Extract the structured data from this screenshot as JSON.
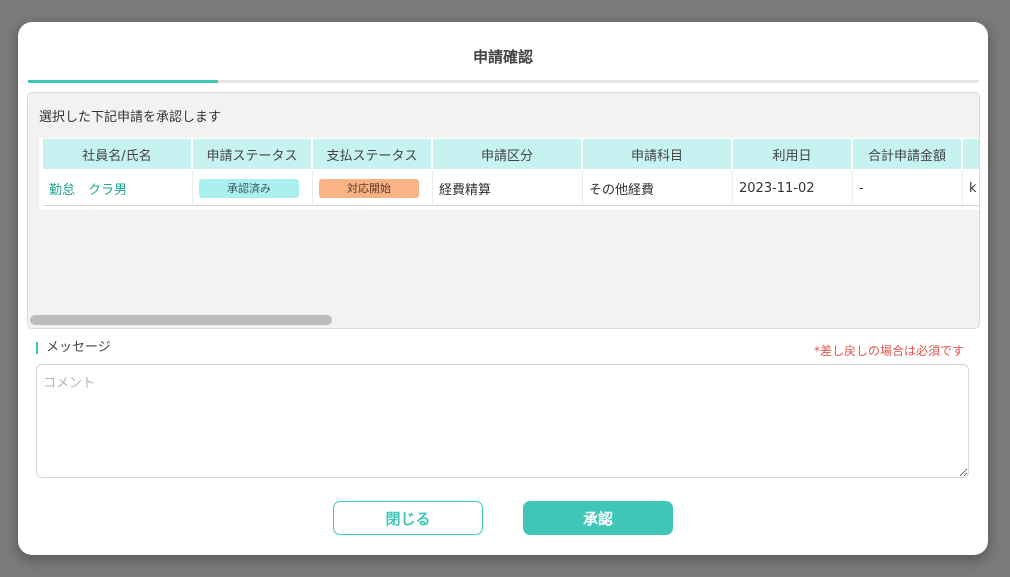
{
  "dialog": {
    "title": "申請確認",
    "instruction": "選択した下記申請を承認します"
  },
  "table": {
    "columns": [
      {
        "key": "name",
        "label": "社員名/氏名",
        "width": 150
      },
      {
        "key": "app_status",
        "label": "申請ステータス",
        "width": 120
      },
      {
        "key": "pay_status",
        "label": "支払ステータス",
        "width": 120
      },
      {
        "key": "category",
        "label": "申請区分",
        "width": 150
      },
      {
        "key": "subject",
        "label": "申請科目",
        "width": 150
      },
      {
        "key": "use_date",
        "label": "利用日",
        "width": 120
      },
      {
        "key": "total",
        "label": "合計申請金額",
        "width": 110
      },
      {
        "key": "extra",
        "label": "",
        "width": 30
      }
    ],
    "rows": [
      {
        "name": "勤怠　クラ男",
        "app_status": "承認済み",
        "pay_status": "対応開始",
        "category": "経費精算",
        "subject": "その他経費",
        "use_date": "2023-11-02",
        "total": "-",
        "extra": "k"
      }
    ]
  },
  "message": {
    "label": "メッセージ",
    "required_note": "*差し戻しの場合は必須です",
    "placeholder": "コメント",
    "value": ""
  },
  "buttons": {
    "close": "閉じる",
    "approve": "承認"
  },
  "colors": {
    "accent": "#3fc6b7",
    "header_bg": "#c6f2f1",
    "badge_approved": "#a9f0ee",
    "badge_payment": "#f9b384",
    "required_red": "#e0584f"
  }
}
